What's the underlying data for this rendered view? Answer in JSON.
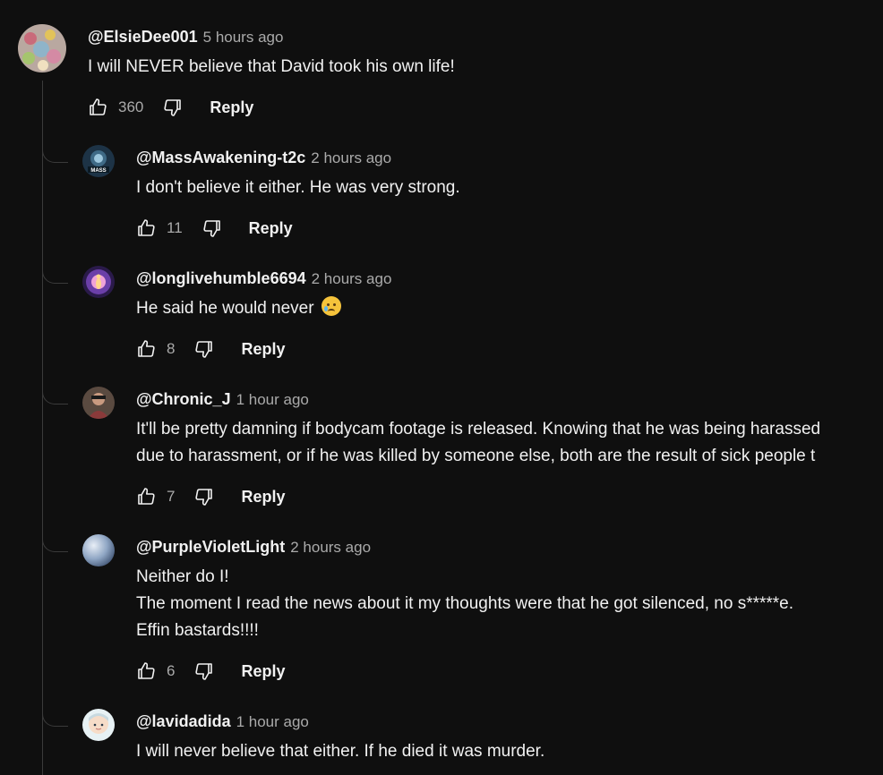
{
  "top_comment": {
    "handle": "@ElsieDee001",
    "time": "5 hours ago",
    "lines": [
      "I will NEVER believe that David took his own life!"
    ],
    "likes": "360",
    "reply_label": "Reply"
  },
  "replies": [
    {
      "handle": "@MassAwakening-t2c",
      "time": "2 hours ago",
      "lines": [
        "I don't believe it either. He was very strong."
      ],
      "likes": "11",
      "reply_label": "Reply",
      "avatar_text": "MASS"
    },
    {
      "handle": "@longlivehumble6694",
      "time": "2 hours ago",
      "lines": [
        "He said he would never"
      ],
      "emoji": "crying-face",
      "likes": "8",
      "reply_label": "Reply"
    },
    {
      "handle": "@Chronic_J",
      "time": "1 hour ago",
      "lines": [
        "It'll be pretty damning if bodycam footage is released. Knowing that he was being harassed",
        "due to harassment, or if he was killed by someone else, both are the result of sick people t"
      ],
      "likes": "7",
      "reply_label": "Reply"
    },
    {
      "handle": "@PurpleVioletLight",
      "time": "2 hours ago",
      "lines": [
        "Neither do I!",
        "The moment I read the news about it my thoughts were that he got silenced, no s*****e.",
        "Effin bastards!!!!"
      ],
      "likes": "6",
      "reply_label": "Reply"
    },
    {
      "handle": "@lavidadida",
      "time": "1 hour ago",
      "lines": [
        "I will never believe that either. If he died it was murder."
      ]
    }
  ],
  "icons": {
    "like": "thumb-up-icon",
    "dislike": "thumb-down-icon"
  },
  "colors": {
    "background": "#0f0f0f",
    "text": "#f1f1f1",
    "secondary": "#aaaaaa",
    "thread_line": "#3a3a3a"
  }
}
